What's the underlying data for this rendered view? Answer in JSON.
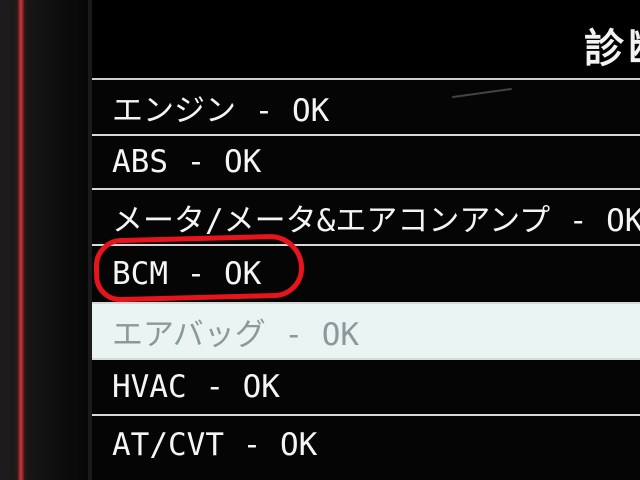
{
  "screen": {
    "title": "診断"
  },
  "items": [
    {
      "label": "エンジン - OK"
    },
    {
      "label": "ABS - OK"
    },
    {
      "label": "メータ/メータ&エアコンアンプ - OK"
    },
    {
      "label": "BCM - OK"
    },
    {
      "label": "エアバッグ - OK"
    },
    {
      "label": "HVAC - OK"
    },
    {
      "label": "AT/CVT - OK"
    }
  ],
  "selected_index": 4,
  "colors": {
    "highlight_background": "#eaf4f3",
    "annotation_circle": "#e8141c",
    "device_trim": "#c23a3d"
  }
}
